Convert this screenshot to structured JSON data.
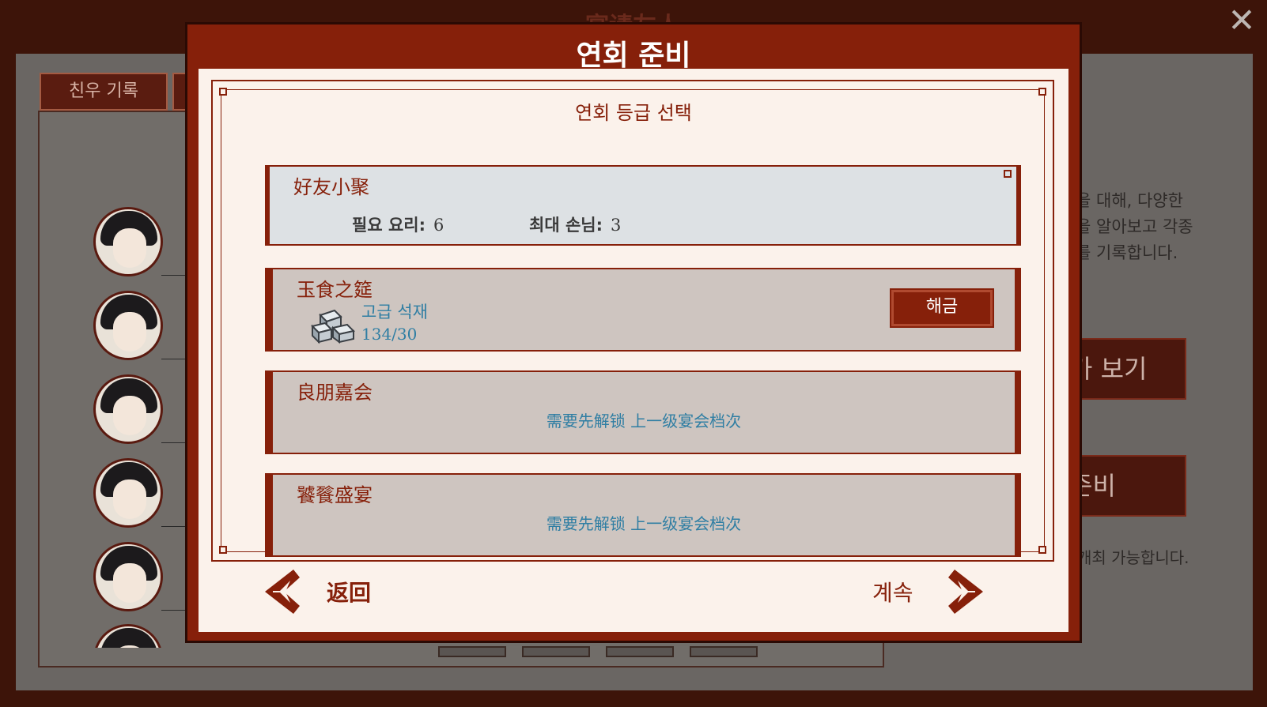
{
  "background": {
    "title": "宴请友人",
    "tab_label": "친우 기록",
    "description": "을 대해, 다양한\n을 알아보고 각종\n를 기록합니다.",
    "btn_view": "가 보기",
    "btn_prepare": "준비",
    "note": "개최 가능합니다."
  },
  "modal": {
    "title": "연회 준비",
    "section_title": "연회 등급 선택",
    "tiers": [
      {
        "name": "好友小聚",
        "req_food_label": "필요 요리:",
        "req_food_value": "6",
        "max_guest_label": "최대 손님:",
        "max_guest_value": "3"
      },
      {
        "name": "玉食之筵",
        "material_name": "고급 석재",
        "material_count": "134/30",
        "material_icon": "stone-blocks-icon",
        "unlock_label": "해금"
      },
      {
        "name": "良朋嘉会",
        "locked_message": "需要先解锁 上一级宴会档次"
      },
      {
        "name": "饕餮盛宴",
        "locked_message": "需要先解锁 上一级宴会档次"
      }
    ],
    "back_label": "返回",
    "continue_label": "계속"
  },
  "colors": {
    "primary": "#86200a",
    "panel_bg": "#fbf2eb",
    "locked_text": "#2f7ea3",
    "tier_bg": "#cec5c0",
    "tier_selected_bg": "#dde1e4"
  }
}
